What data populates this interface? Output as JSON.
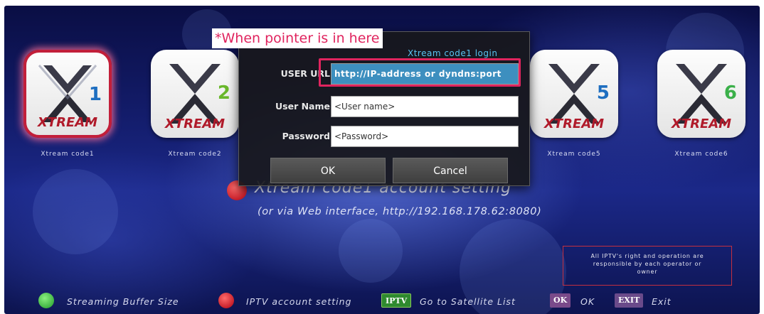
{
  "tiles": [
    {
      "label": "Xtream code1",
      "brand": "XTREAM",
      "number": "1",
      "color": "#1e6ec0"
    },
    {
      "label": "Xtream code2",
      "brand": "XTREAM",
      "number": "2",
      "color": "#6ab82c"
    },
    {
      "label": "Xtream code5",
      "brand": "XTREAM",
      "number": "5",
      "color": "#1e6ec0"
    },
    {
      "label": "Xtream code6",
      "brand": "XTREAM",
      "number": "6",
      "color": "#3bb04a"
    }
  ],
  "dialog": {
    "title": "Xtream code1 login",
    "fields": [
      {
        "label": "USER URL",
        "value": "http://IP-address or dyndns:port"
      },
      {
        "label": "User Name",
        "value": "<User name>"
      },
      {
        "label": "Password",
        "value": "<Password>"
      }
    ],
    "ok_label": "OK",
    "cancel_label": "Cancel"
  },
  "callout": "*When pointer is in here",
  "account_hint": {
    "title": "Xtream code1 account setting",
    "subtitle": "(or via Web interface, http://192.168.178.62:8080)"
  },
  "disclaimer": {
    "line1": "All IPTV's right and operation are",
    "line2": "responsible by each operator or",
    "line3": "owner"
  },
  "legend": {
    "green_text": "Streaming Buffer Size",
    "red_text": "IPTV account setting",
    "iptv_badge": "IPTV",
    "iptv_text": "Go to Satellite List",
    "ok_badge": "OK",
    "ok_text": "OK",
    "exit_badge": "EXIT",
    "exit_text": "Exit"
  },
  "colors": {
    "accent": "#e0245e",
    "selected_border": "#c21f3a",
    "active_field": "#3d8fbf",
    "title_blue": "#58c3f0",
    "green_button": "#2fbf3a",
    "red_button": "#d0101e"
  }
}
